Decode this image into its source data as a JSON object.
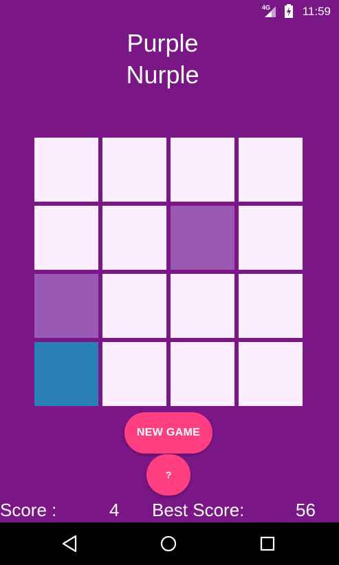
{
  "status_bar": {
    "network": "4G",
    "time": "11:59",
    "icons": [
      "signal-icon",
      "battery-charging-icon"
    ]
  },
  "app": {
    "title_line1": "Purple",
    "title_line2": "Nurple"
  },
  "colors": {
    "background": "#7B1687",
    "tile_empty": "#FCEEFC",
    "tile_purple": "#9B59B6",
    "tile_blue": "#2980B9",
    "accent": "#FF3F81"
  },
  "grid": {
    "rows": 4,
    "cols": 4,
    "cells": [
      "empty",
      "empty",
      "empty",
      "empty",
      "empty",
      "empty",
      "purple",
      "empty",
      "purple",
      "empty",
      "empty",
      "empty",
      "blue",
      "empty",
      "empty",
      "empty"
    ]
  },
  "buttons": {
    "new_game": "NEW GAME",
    "help": "?"
  },
  "scoreboard": {
    "score_label": "Score :",
    "score_value": "4",
    "best_label": "Best Score:",
    "best_value": "56"
  },
  "nav_bar": {
    "icons": [
      "back-icon",
      "home-icon",
      "recents-icon"
    ]
  }
}
